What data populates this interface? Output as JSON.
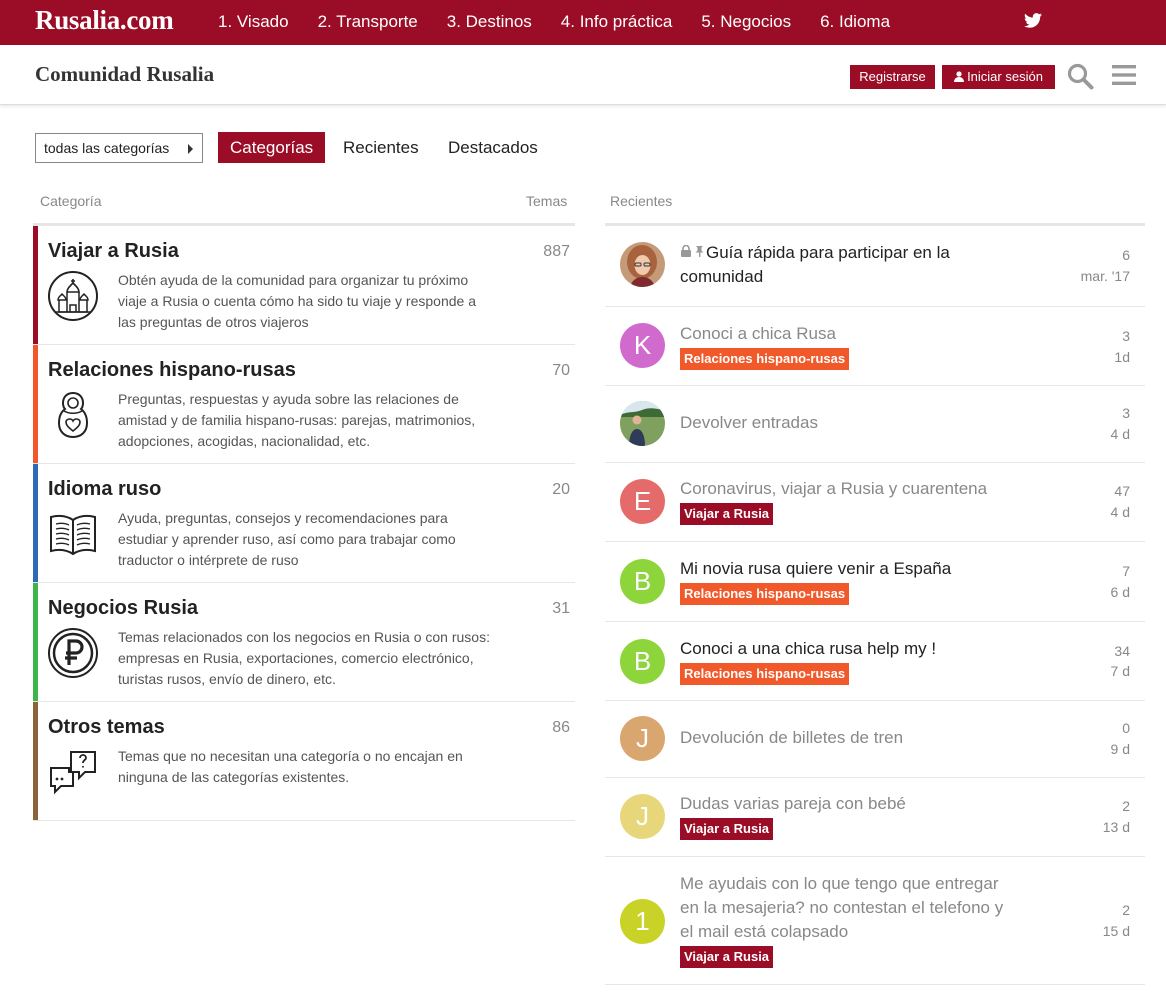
{
  "topbar": {
    "brand": "Rusalia.com",
    "nav": [
      "1. Visado",
      "2. Transporte",
      "3. Destinos",
      "4. Info práctica",
      "5. Negocios",
      "6. Idioma"
    ]
  },
  "header": {
    "title": "Comunidad Rusalia",
    "register": "Registrarse",
    "login": "Iniciar sesión"
  },
  "navigation": {
    "category_dropdown": "todas las categorías",
    "tabs": [
      "Categorías",
      "Recientes",
      "Destacados"
    ]
  },
  "categories_table": {
    "header_category": "Categoría",
    "header_topics": "Temas",
    "rows": [
      {
        "name": "Viajar a Rusia",
        "count": "887",
        "color": "#9b0d26",
        "icon": "church-icon",
        "description": "Obtén ayuda de la comunidad para organizar tu próximo viaje a Rusia o cuenta cómo ha sido tu viaje y responde a las preguntas de otros viajeros"
      },
      {
        "name": "Relaciones hispano-rusas",
        "count": "70",
        "color": "#f1592a",
        "icon": "matryoshka-icon",
        "description": "Preguntas, respuestas y ayuda sobre las relaciones de amistad y de familia hispano-rusas: parejas, matrimonios, adopciones, acogidas, nacionalidad, etc."
      },
      {
        "name": "Idioma ruso",
        "count": "20",
        "color": "#2e6ab3",
        "icon": "book-icon",
        "description": "Ayuda, preguntas, consejos y recomendaciones para estudiar y aprender ruso, así como para trabajar como traductor o intérprete de ruso"
      },
      {
        "name": "Negocios Rusia",
        "count": "31",
        "color": "#3cb54a",
        "icon": "ruble-icon",
        "description": "Temas relacionados con los negocios en Rusia o con rusos: empresas en Rusia, exportaciones, comercio electrónico, turistas rusos, envío de dinero, etc."
      },
      {
        "name": "Otros temas",
        "count": "86",
        "color": "#8c6238",
        "icon": "chat-question-icon",
        "description": "Temas que no necesitan una categoría o no encajan en ninguna de las categorías existentes."
      }
    ]
  },
  "recent": {
    "header": "Recientes",
    "topics": [
      {
        "title": "Guía rápida para participar en la comunidad",
        "posts": "6",
        "age": "mar. '17",
        "avatar": "",
        "avatar_color": "#b07a5a"
      },
      {
        "title": "Conoci a chica Rusa",
        "category": "Relaciones hispano-rusas",
        "category_color": "#f1592a",
        "posts": "3",
        "age": "1d",
        "avatar": "K",
        "avatar_color": "#d06bcd"
      },
      {
        "title": "Devolver entradas",
        "posts": "3",
        "age": "4 d",
        "avatar": "",
        "avatar_color": "#5a7a4a"
      },
      {
        "title": "Coronavirus, viajar a Rusia y cuarentena",
        "category": "Viajar a Rusia",
        "category_color": "#9b0d26",
        "posts": "47",
        "age": "4 d",
        "avatar": "E",
        "avatar_color": "#e56a6a"
      },
      {
        "title": "Mi novia rusa quiere venir a España",
        "category": "Relaciones hispano-rusas",
        "category_color": "#f1592a",
        "posts": "7",
        "age": "6 d",
        "avatar": "B",
        "avatar_color": "#8ed43b"
      },
      {
        "title": "Conoci a una chica rusa help my !",
        "category": "Relaciones hispano-rusas",
        "category_color": "#f1592a",
        "posts": "34",
        "age": "7 d",
        "avatar": "B",
        "avatar_color": "#8ed43b"
      },
      {
        "title": "Devolución de billetes de tren",
        "posts": "0",
        "age": "9 d",
        "avatar": "J",
        "avatar_color": "#d9a66f"
      },
      {
        "title": "Dudas varias pareja con bebé",
        "category": "Viajar a Rusia",
        "category_color": "#9b0d26",
        "posts": "2",
        "age": "13 d",
        "avatar": "J",
        "avatar_color": "#e8d77a"
      },
      {
        "title": "Me ayudais con lo que tengo que entregar en la mesajeria? no contestan el telefono y el mail está colapsado",
        "category": "Viajar a Rusia",
        "category_color": "#9b0d26",
        "posts": "2",
        "age": "15 d",
        "avatar": "1",
        "avatar_color": "#c9d227"
      }
    ]
  }
}
